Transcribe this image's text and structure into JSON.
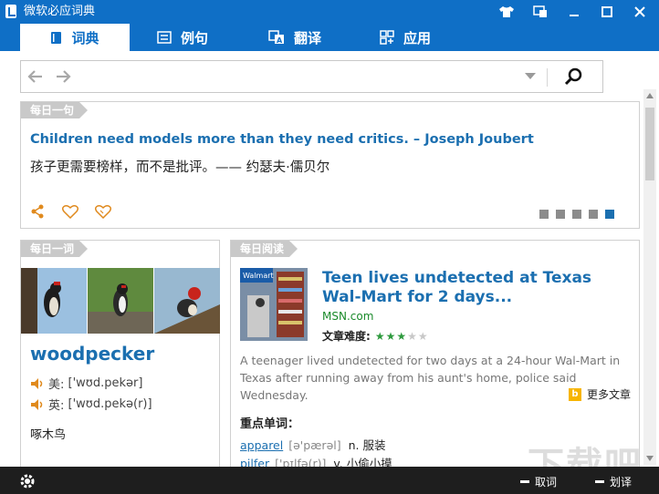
{
  "window": {
    "title": "微软必应词典"
  },
  "tabs": [
    {
      "label": "词典",
      "icon": "book-icon",
      "active": true
    },
    {
      "label": "例句",
      "icon": "list-icon",
      "active": false
    },
    {
      "label": "翻译",
      "icon": "translate-icon",
      "active": false
    },
    {
      "label": "应用",
      "icon": "apps-icon",
      "active": false
    }
  ],
  "search": {
    "value": "",
    "placeholder": ""
  },
  "daily_sentence": {
    "tag": "每日一句",
    "english": "Children need models more than they need critics. – Joseph Joubert",
    "chinese": "孩子更需要榜样，而不是批评。—— 约瑟夫·儒贝尔",
    "page_count": 5,
    "active_page": 5
  },
  "daily_word": {
    "tag": "每日一词",
    "word": "woodpecker",
    "us_label": "美:",
    "us_phonetic": "['wʊd.pekər]",
    "uk_label": "英:",
    "uk_phonetic": "['wʊd.pekə(r)]",
    "definition": "啄木鸟"
  },
  "daily_reading": {
    "tag": "每日阅读",
    "title": "Teen lives undetected at Texas Wal-Mart for 2 days...",
    "source": "MSN.com",
    "difficulty_label": "文章难度:",
    "difficulty_rating": 3,
    "difficulty_max": 5,
    "summary": "A teenager lived undetected for two days at a 24-hour Wal-Mart in Texas after running away from his aunt's home, police said Wednesday.",
    "more_label": "更多文章",
    "bing_letter": "b",
    "keywords_title": "重点单词：",
    "keywords": [
      {
        "word": "apparel",
        "phonetic": "[ə'pærəl]",
        "definition": "n. 服装"
      },
      {
        "word": "pilfer",
        "phonetic": "['pɪlfə(r)]",
        "definition": "v. 小偷小摸"
      }
    ],
    "thumb_text": "Walmart"
  },
  "statusbar": {
    "lookup_label": "取词",
    "highlight_label": "划译"
  },
  "watermark": "下载吧",
  "colors": {
    "brand_blue": "#0f6fc6",
    "link_blue": "#1b6fb0",
    "star_green": "#2e9a3e",
    "status_bg": "#1e1e1e"
  }
}
